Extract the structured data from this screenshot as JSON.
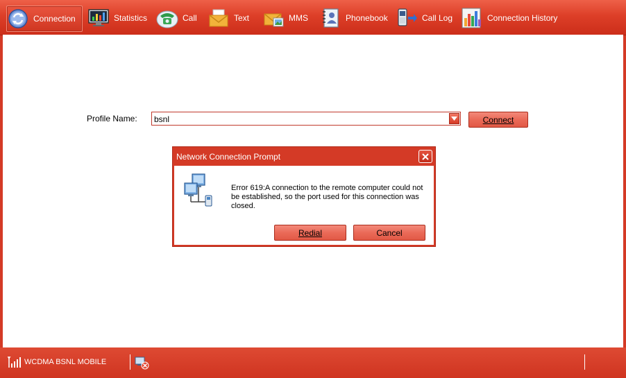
{
  "toolbar": {
    "items": [
      {
        "label": "Connection",
        "icon": "connection-icon",
        "active": true
      },
      {
        "label": "Statistics",
        "icon": "statistics-icon"
      },
      {
        "label": "Call",
        "icon": "call-icon"
      },
      {
        "label": "Text",
        "icon": "text-envelope-icon"
      },
      {
        "label": "MMS",
        "icon": "mms-icon"
      },
      {
        "label": "Phonebook",
        "icon": "phonebook-icon"
      },
      {
        "label": "Call Log",
        "icon": "call-log-icon"
      },
      {
        "label": "Connection History",
        "icon": "connection-history-icon"
      }
    ]
  },
  "connection": {
    "profile_label": "Profile Name:",
    "profile_value": "bsnl",
    "connect_label": "Connect"
  },
  "dialog": {
    "title": "Network Connection Prompt",
    "message": "Error 619:A connection to the remote computer could not be established, so the port used for this connection was closed.",
    "redial_label": "Redial",
    "cancel_label": "Cancel",
    "icon": "network-computers-icon"
  },
  "status": {
    "network": "WCDMA  BSNL MOBILE",
    "signal_icon": "signal-bars-icon",
    "disconnected_icon": "disconnected-icon"
  },
  "colors": {
    "accent": "#d43a26",
    "button": "#ea6a58",
    "panel": "#ffffff"
  }
}
